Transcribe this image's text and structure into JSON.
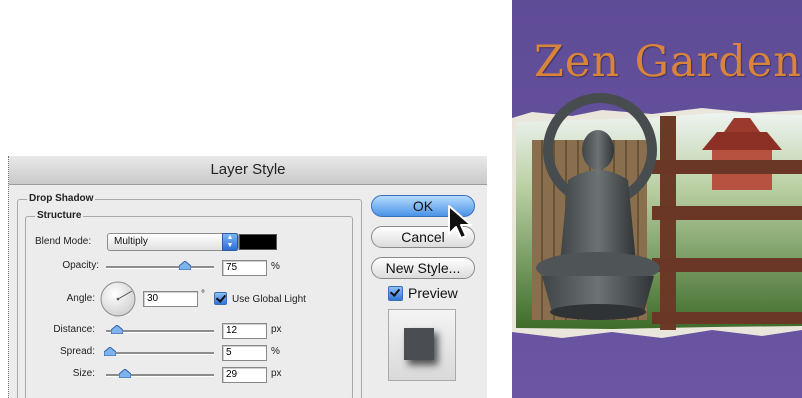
{
  "dialog": {
    "title": "Layer Style",
    "section_title": "Drop Shadow",
    "group_title": "Structure",
    "blend_mode": {
      "label": "Blend Mode:",
      "value": "Multiply",
      "color": "#000000"
    },
    "opacity": {
      "label": "Opacity:",
      "value": "75",
      "unit": "%",
      "level": 0.75
    },
    "angle": {
      "label": "Angle:",
      "value": "30",
      "unit": "°",
      "global_light_label": "Use Global Light",
      "global_light_checked": true
    },
    "distance": {
      "label": "Distance:",
      "value": "12",
      "unit": "px",
      "level": 0.12
    },
    "spread": {
      "label": "Spread:",
      "value": "5",
      "unit": "%",
      "level": 0.05
    },
    "size": {
      "label": "Size:",
      "value": "29",
      "unit": "px",
      "level": 0.2
    },
    "buttons": {
      "ok": "OK",
      "cancel": "Cancel",
      "new_style": "New Style..."
    },
    "preview": {
      "label": "Preview",
      "checked": true
    }
  },
  "artwork": {
    "title": "Zen Garden",
    "title_color": "#d8843a",
    "background_color": "#6a55a0"
  }
}
